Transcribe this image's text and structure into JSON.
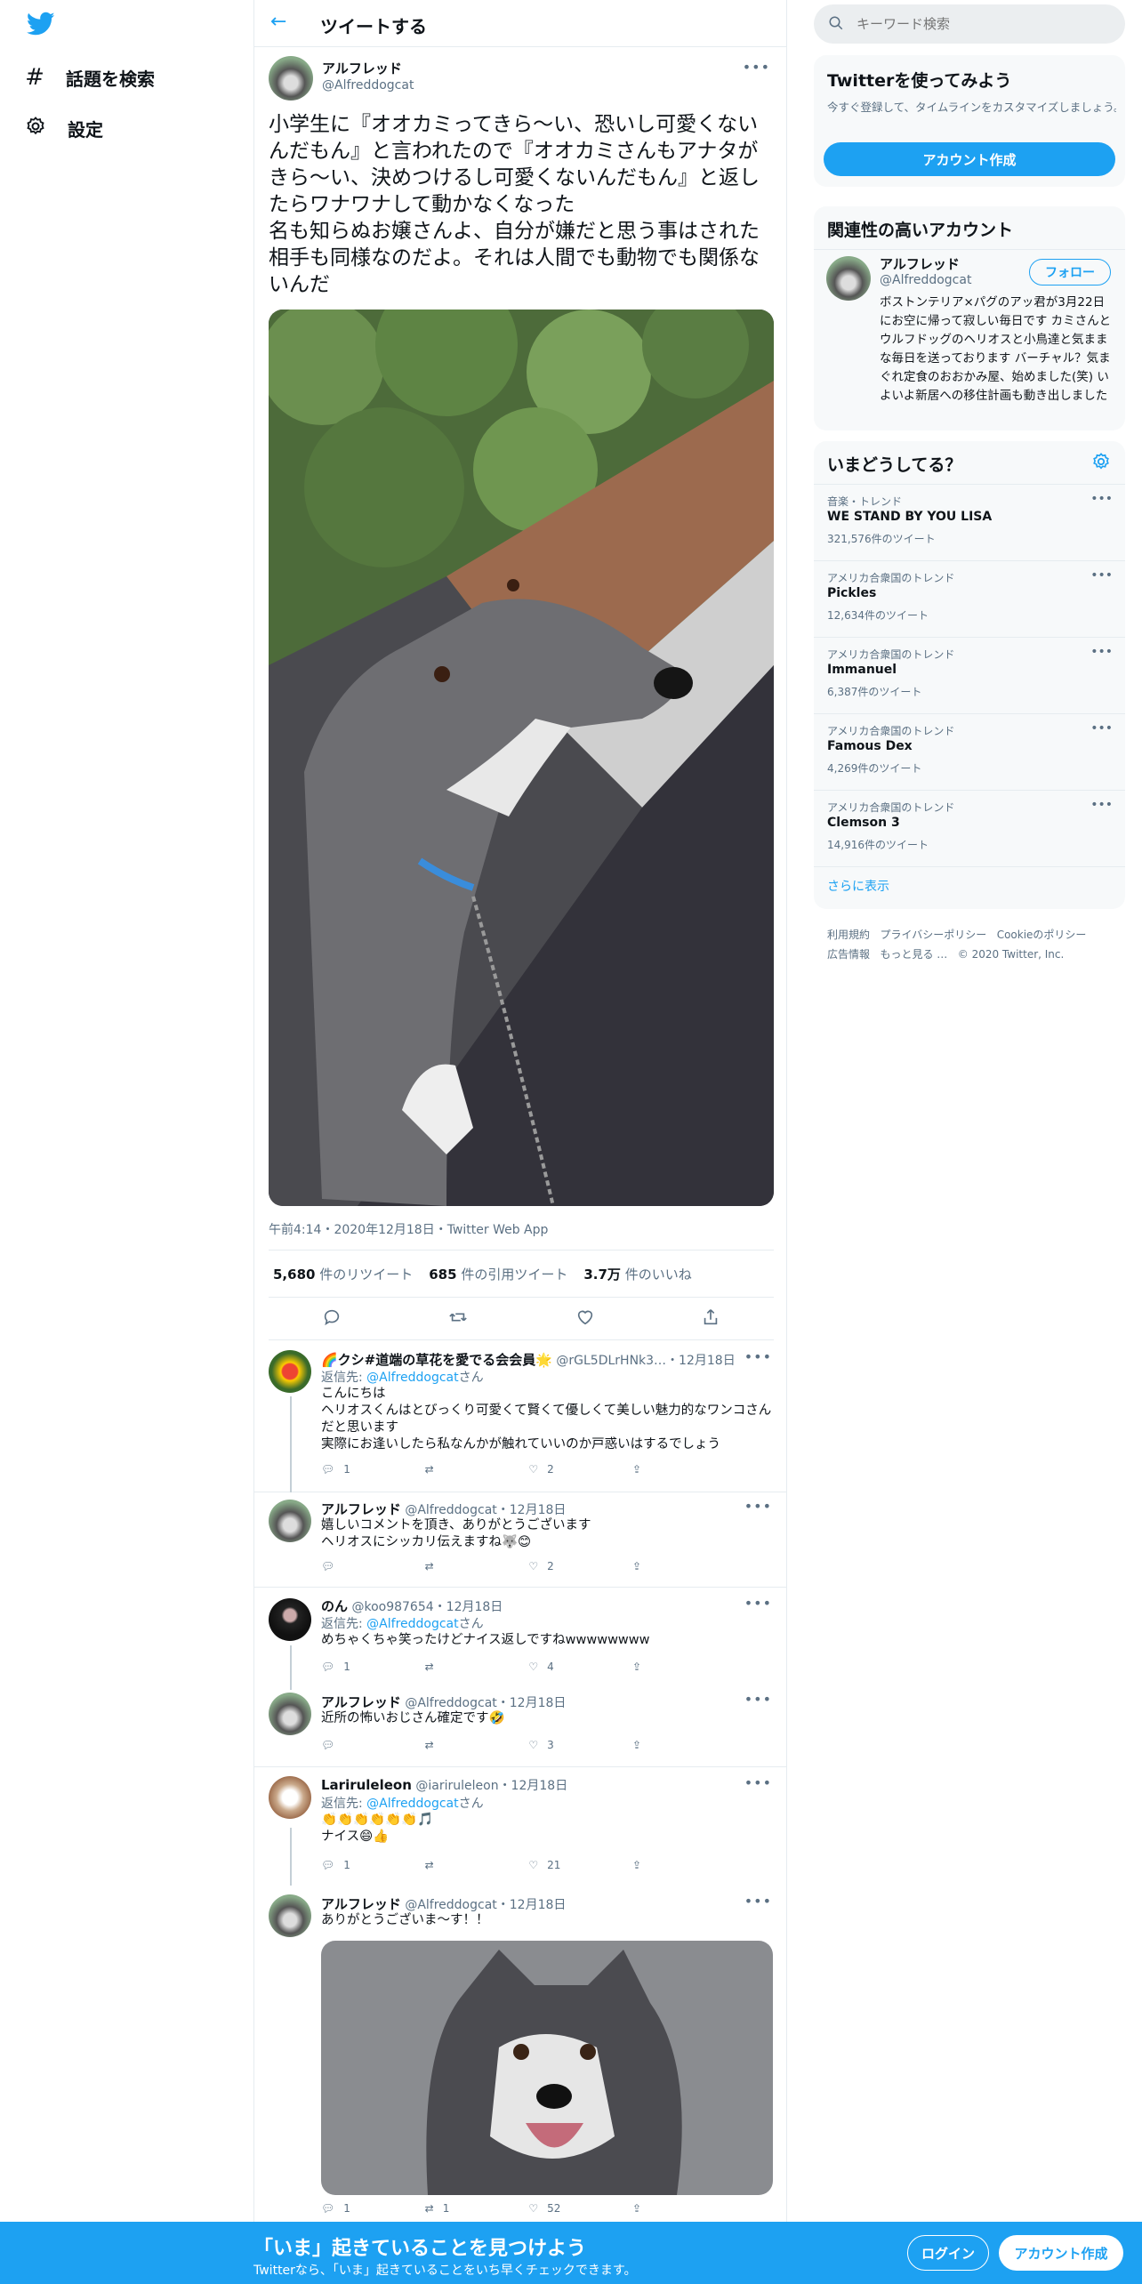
{
  "nav": {
    "explore": "話題を検索",
    "settings": "設定"
  },
  "header": {
    "title": "ツイートする"
  },
  "tweet": {
    "name": "アルフレッド",
    "handle": "@Alfreddogcat",
    "text": "小学生に『オオカミってきら〜い、恐いし可愛くないんだもん』と言われたので『オオカミさんもアナタがきら〜い、決めつけるし可愛くないんだもん』と返したらワナワナして動かなくなった\n名も知らぬお嬢さんよ、自分が嫌だと思う事はされた相手も同様なのだよ。それは人間でも動物でも関係ないんだ",
    "timestamp": "午前4:14・2020年12月18日・Twitter Web App",
    "retweets": "5,680",
    "retweets_label": "件のリツイート",
    "quotes": "685",
    "quotes_label": "件の引用ツイート",
    "likes": "3.7万",
    "likes_label": "件のいいね"
  },
  "replies": [
    {
      "name": "🌈クシ#道端の草花を愛でる会会員🌟",
      "handle": "@rGL5DLrHNk3…",
      "date": "・12月18日",
      "reply_to_prefix": "返信先: ",
      "reply_to": "@Alfreddogcat",
      "reply_to_suffix": "さん",
      "text": "こんにちは\nヘリオスくんはとびっくり可愛くて賢くて優しくて美しい魅力的なワンコさんだと思います\n実際にお逢いしたら私なんかが触れていいのか戸惑いはするでしょう",
      "replies": "1",
      "retweets": "",
      "likes": "2"
    },
    {
      "name": "アルフレッド",
      "handle": "@Alfreddogcat",
      "date": "・12月18日",
      "text": "嬉しいコメントを頂き、ありがとうございます\nヘリオスにシッカリ伝えますね🐺😊",
      "replies": "",
      "retweets": "",
      "likes": "2"
    },
    {
      "name": "のん",
      "handle": "@koo987654",
      "date": "・12月18日",
      "reply_to_prefix": "返信先: ",
      "reply_to": "@Alfreddogcat",
      "reply_to_suffix": "さん",
      "text": "めちゃくちゃ笑ったけどナイス返しですねwwwwwwww",
      "replies": "1",
      "retweets": "",
      "likes": "4"
    },
    {
      "name": "アルフレッド",
      "handle": "@Alfreddogcat",
      "date": "・12月18日",
      "text": "近所の怖いおじさん確定です🤣",
      "replies": "",
      "retweets": "",
      "likes": "3"
    },
    {
      "name": "Lariruleleon",
      "handle": "@iariruleleon",
      "date": "・12月18日",
      "reply_to_prefix": "返信先: ",
      "reply_to": "@Alfreddogcat",
      "reply_to_suffix": "さん",
      "text": "👏👏👏👏👏👏🎵\nナイス😄👍",
      "replies": "1",
      "retweets": "",
      "likes": "21"
    },
    {
      "name": "アルフレッド",
      "handle": "@Alfreddogcat",
      "date": "・12月18日",
      "text": "ありがとうございま〜す！！",
      "replies": "1",
      "retweets": "1",
      "likes": "52"
    }
  ],
  "search": {
    "placeholder": "キーワード検索"
  },
  "signup_card": {
    "title": "Twitterを使ってみよう",
    "desc": "今すぐ登録して、タイムラインをカスタマイズしましょう。",
    "button": "アカウント作成"
  },
  "related": {
    "title": "関連性の高いアカウント",
    "name": "アルフレッド",
    "handle": "@Alfreddogcat",
    "follow": "フォロー",
    "bio": "ボストンテリア×パグのアッ君が3月22日にお空に帰って寂しい毎日です カミさんとウルフドッグのヘリオスと小鳥達と気ままな毎日を送っております バーチャル？気まぐれ定食のおおかみ屋、始めました(笑) いよいよ新居への移住計画も動き出しました"
  },
  "trends": {
    "title": "いまどうしてる？",
    "items": [
      {
        "context": "音楽・トレンド",
        "name": "WE STAND BY YOU LISA",
        "count": "321,576件のツイート"
      },
      {
        "context": "アメリカ合衆国のトレンド",
        "name": "Pickles",
        "count": "12,634件のツイート"
      },
      {
        "context": "アメリカ合衆国のトレンド",
        "name": "Immanuel",
        "count": "6,387件のツイート"
      },
      {
        "context": "アメリカ合衆国のトレンド",
        "name": "Famous Dex",
        "count": "4,269件のツイート"
      },
      {
        "context": "アメリカ合衆国のトレンド",
        "name": "Clemson 3",
        "count": "14,916件のツイート"
      }
    ],
    "show_more": "さらに表示"
  },
  "footer": {
    "terms": "利用規約",
    "privacy": "プライバシーポリシー",
    "cookie": "Cookieのポリシー",
    "ads": "広告情報",
    "more": "もっと見る …",
    "copyright": "© 2020 Twitter, Inc."
  },
  "bottom": {
    "headline": "「いま」起きていることを見つけよう",
    "sub": "Twitterなら、「いま」起きていることをいち早くチェックできます。",
    "login": "ログイン",
    "signup": "アカウント作成"
  },
  "colors": {
    "accent": "#1da1f2",
    "border": "#e6ecf0",
    "muted": "#5b7083"
  }
}
